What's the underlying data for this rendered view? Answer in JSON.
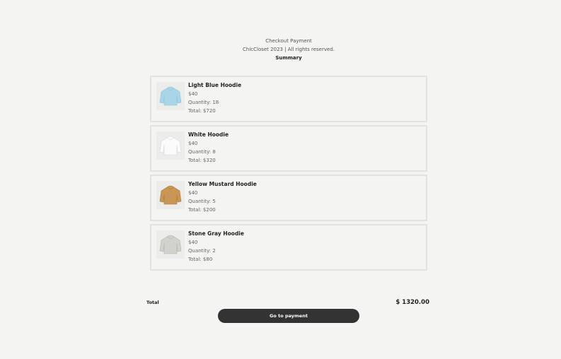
{
  "header": {
    "title": "Checkout Payment",
    "copyright": "ChicCloset 2023 | All rights reserved.",
    "summary": "Summary"
  },
  "items": [
    {
      "name": "Light Blue Hoodie",
      "price": "$40",
      "quantity": "Quantity: 18",
      "total": "Total: $720",
      "color": "#a8d6e8",
      "icon": "light-blue-hoodie-icon"
    },
    {
      "name": "White Hoodie",
      "price": "$40",
      "quantity": "Quantity: 8",
      "total": "Total: $320",
      "color": "#fbfbfb",
      "icon": "white-hoodie-icon"
    },
    {
      "name": "Yellow Mustard Hoodie",
      "price": "$40",
      "quantity": "Quantity: 5",
      "total": "Total: $200",
      "color": "#c99656",
      "icon": "mustard-hoodie-icon"
    },
    {
      "name": "Stone Gray Hoodie",
      "price": "$40",
      "quantity": "Quantity: 2",
      "total": "Total: $80",
      "color": "#d1d2cc",
      "icon": "gray-hoodie-icon"
    }
  ],
  "summary": {
    "total_label": "Total",
    "total_value": "$ 1320.00"
  },
  "payment_button": "Go to payment"
}
